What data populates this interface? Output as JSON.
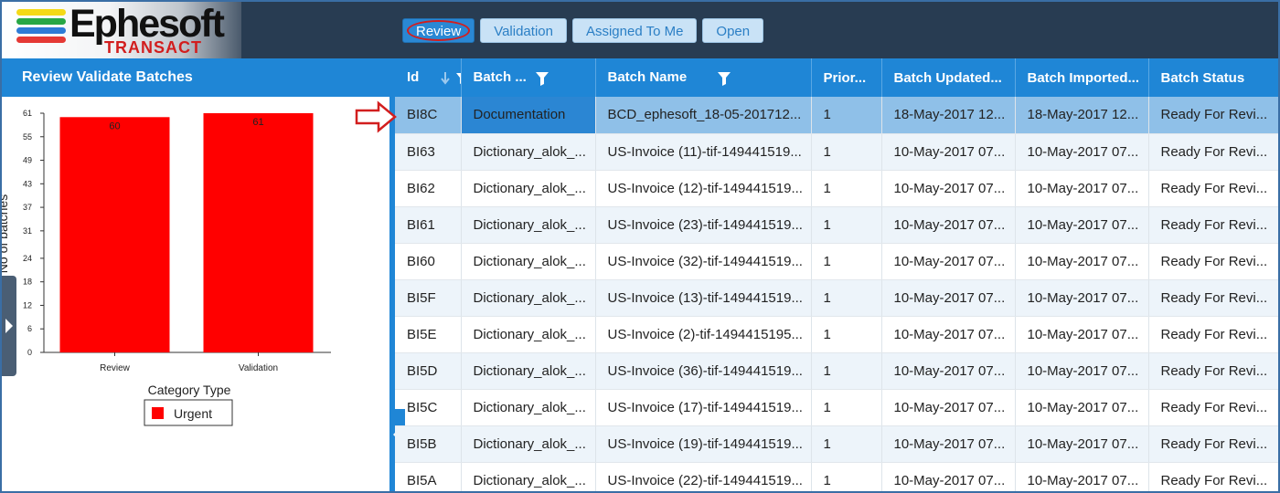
{
  "app": {
    "logo_text": "Ephesoft",
    "logo_sub": "TRANSACT"
  },
  "tabs": [
    {
      "label": "Review",
      "active": true
    },
    {
      "label": "Validation",
      "active": false
    },
    {
      "label": "Assigned To Me",
      "active": false
    },
    {
      "label": "Open",
      "active": false
    }
  ],
  "left_panel": {
    "title": "Review Validate Batches"
  },
  "chart_data": {
    "type": "bar",
    "categories": [
      "Review",
      "Validation"
    ],
    "series": [
      {
        "name": "Urgent",
        "values": [
          60,
          61
        ],
        "color": "#ff0000"
      }
    ],
    "ylabel": "No of batches",
    "xlabel": "",
    "yticks": [
      0,
      6,
      12,
      18,
      24,
      31,
      37,
      43,
      49,
      55,
      61
    ],
    "ylim": [
      0,
      61
    ],
    "data_labels": [
      "60",
      "61"
    ],
    "legend_title": "Category Type",
    "legend": [
      "Urgent"
    ],
    "legend_position": "bottom"
  },
  "table": {
    "columns": [
      "Id",
      "Batch ...",
      "Batch Name",
      "Prior...",
      "Batch Updated...",
      "Batch Imported...",
      "Batch Status"
    ],
    "rows": [
      [
        "BI8C",
        "Documentation",
        "BCD_ephesoft_18-05-201712...",
        "1",
        "18-May-2017 12...",
        "18-May-2017 12...",
        "Ready For Revi..."
      ],
      [
        "BI63",
        "Dictionary_alok_...",
        "US-Invoice (11)-tif-149441519...",
        "1",
        "10-May-2017 07...",
        "10-May-2017 07...",
        "Ready For Revi..."
      ],
      [
        "BI62",
        "Dictionary_alok_...",
        "US-Invoice (12)-tif-149441519...",
        "1",
        "10-May-2017 07...",
        "10-May-2017 07...",
        "Ready For Revi..."
      ],
      [
        "BI61",
        "Dictionary_alok_...",
        "US-Invoice (23)-tif-149441519...",
        "1",
        "10-May-2017 07...",
        "10-May-2017 07...",
        "Ready For Revi..."
      ],
      [
        "BI60",
        "Dictionary_alok_...",
        "US-Invoice (32)-tif-149441519...",
        "1",
        "10-May-2017 07...",
        "10-May-2017 07...",
        "Ready For Revi..."
      ],
      [
        "BI5F",
        "Dictionary_alok_...",
        "US-Invoice (13)-tif-149441519...",
        "1",
        "10-May-2017 07...",
        "10-May-2017 07...",
        "Ready For Revi..."
      ],
      [
        "BI5E",
        "Dictionary_alok_...",
        "US-Invoice (2)-tif-1494415195...",
        "1",
        "10-May-2017 07...",
        "10-May-2017 07...",
        "Ready For Revi..."
      ],
      [
        "BI5D",
        "Dictionary_alok_...",
        "US-Invoice (36)-tif-149441519...",
        "1",
        "10-May-2017 07...",
        "10-May-2017 07...",
        "Ready For Revi..."
      ],
      [
        "BI5C",
        "Dictionary_alok_...",
        "US-Invoice (17)-tif-149441519...",
        "1",
        "10-May-2017 07...",
        "10-May-2017 07...",
        "Ready For Revi..."
      ],
      [
        "BI5B",
        "Dictionary_alok_...",
        "US-Invoice (19)-tif-149441519...",
        "1",
        "10-May-2017 07...",
        "10-May-2017 07...",
        "Ready For Revi..."
      ],
      [
        "BI5A",
        "Dictionary_alok_...",
        "US-Invoice (22)-tif-149441519...",
        "1",
        "10-May-2017 07...",
        "10-May-2017 07...",
        "Ready For Revi..."
      ]
    ]
  },
  "colors": {
    "accent": "#1f86d6",
    "header_bg": "#283c52",
    "selected_row": "#8fc0e8",
    "bar": "#ff0000",
    "annotation": "#d21e1e"
  },
  "icons": {
    "sort": "sort-down-icon",
    "filter": "filter-icon",
    "annotation_arrow": "arrow-right-icon"
  }
}
